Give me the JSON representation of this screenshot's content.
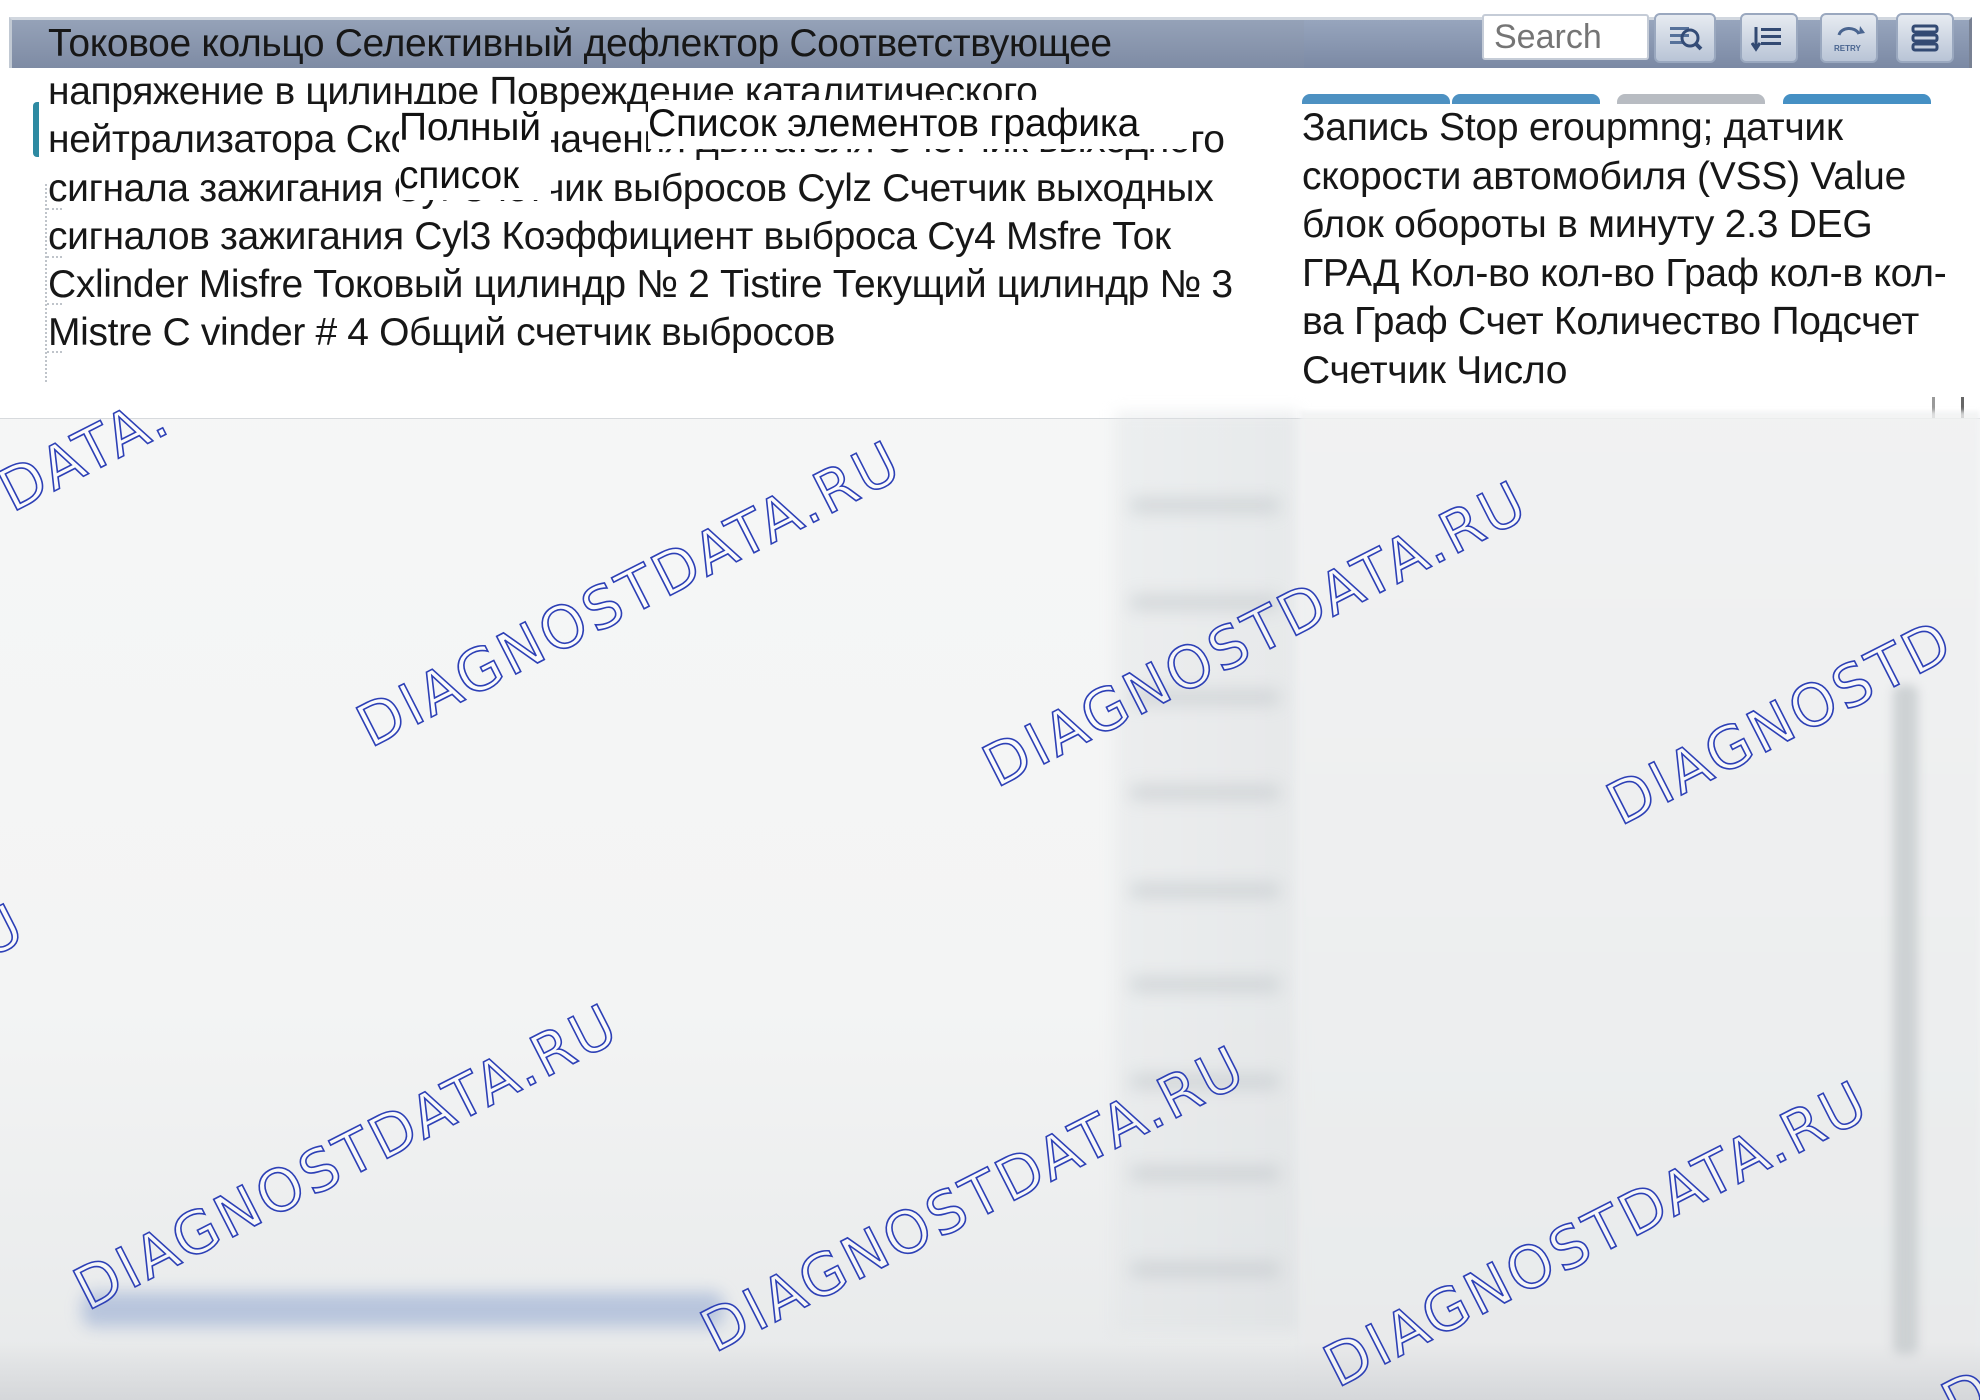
{
  "top_bar": {
    "search_placeholder": "Search",
    "retry_text": "RETRY",
    "icons": {
      "search": "search-list-icon",
      "list": "sort-list-icon",
      "retry": "retry-icon",
      "menu": "menu-icon"
    }
  },
  "content": {
    "main_text": "Токовое кольцо Селективный дефлектор Соответствующее напряжение в цилиндре Повреждение каталитического нейтрализатора Скорость значения двигателя Счетчик выходного сигнала зажигания Cyl Счетчик выбросов Cylz Счетчик выходных сигналов зажигания Cyl3 Коэффициент выброса Cy4 Msfre Ток Cxlinder Misfre Токовый цилиндр № 2 Tistire Текущий цилиндр № 3 Mistre C vinder # 4 Общий счетчик выбросов",
    "overlay_full_list": "Полный список",
    "overlay_graph_list": "Список элементов графика",
    "right_text": "Запись Stop eroupmng; датчик скорости автомобиля (VSS) Value блок обороты в минуту 2.3 DEG ГРАД Кол-во кол-во Граф кол-в кол-ва Граф Счет Количество Подсчет Счетчик Число"
  },
  "watermark": {
    "text_long": "DIAGNOSTDATA.RU",
    "text_short": "DIAGNOSTD",
    "text_cut": "STDATA.",
    "text_ru": "RU"
  },
  "colors": {
    "toolbar": "#8591aa",
    "accent": "#2e8aa2",
    "watermark": "#2d40b6"
  }
}
